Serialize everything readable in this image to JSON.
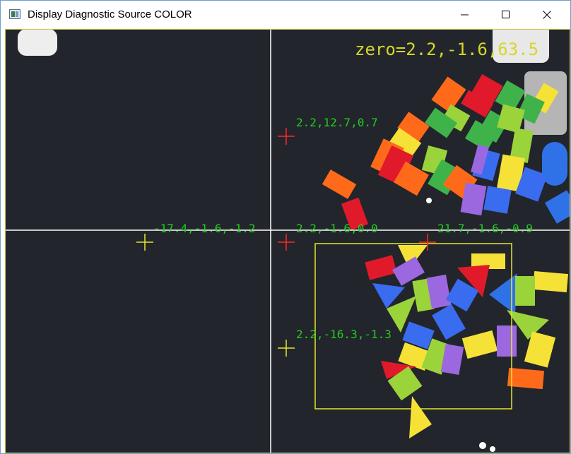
{
  "window": {
    "title": "Display Diagnostic Source COLOR",
    "icon": "app-window-icon",
    "controls": [
      "minimize-icon",
      "maximize-icon",
      "close-icon"
    ]
  },
  "overlay": {
    "zero_label": "zero=2.2,-1.6,63.5",
    "points": [
      {
        "label": "2.2,12.7,0.7",
        "color": "#ff2a2a"
      },
      {
        "label": "-17.4,-1.6,-1.2",
        "color": "#e6e62a"
      },
      {
        "label": "2.2,-1.6,0.0",
        "color": "#ff2a2a"
      },
      {
        "label": "21.7,-1.6,-0.9",
        "color": "#ff2a2a"
      },
      {
        "label": "2.2,-16.3,-1.3",
        "color": "#e6e62a"
      }
    ],
    "label_color": "#22cc22",
    "crosshair_color": "#ffffff",
    "roi_color": "#e6e62a"
  },
  "colors": {
    "background": "#22252b",
    "title_bar": "#ffffff",
    "window_border": "#6f9fcf"
  }
}
